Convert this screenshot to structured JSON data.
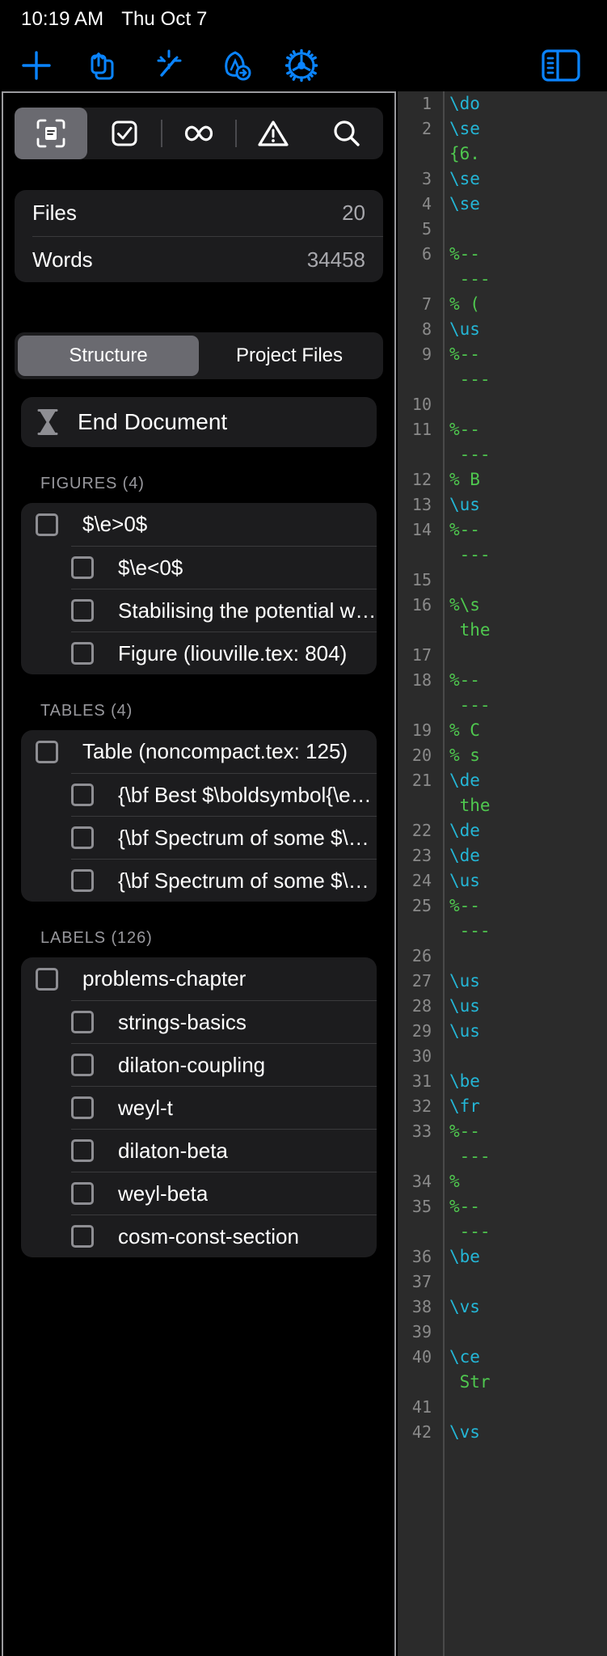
{
  "status_bar": {
    "time": "10:19 AM",
    "date": "Thu Oct 7"
  },
  "app_toolbar": {
    "icons": [
      {
        "name": "add-icon",
        "label": "+"
      },
      {
        "name": "share-icon",
        "label": "Share"
      },
      {
        "name": "magic-wand-icon",
        "label": "Magic"
      },
      {
        "name": "typeset-icon",
        "label": "Typeset"
      },
      {
        "name": "settings-gear-icon",
        "label": "Settings"
      }
    ],
    "right_icon": {
      "name": "sidebar-toggle-icon",
      "label": "Toggle Sidebar"
    }
  },
  "inspector": {
    "segmented": [
      {
        "name": "document-info-tab",
        "icon": "document-scan-icon",
        "active": true
      },
      {
        "name": "todo-tab",
        "icon": "checkbox-icon",
        "active": false
      },
      {
        "name": "math-tab",
        "icon": "infinity-icon",
        "active": false
      },
      {
        "name": "warnings-tab",
        "icon": "warning-triangle-icon",
        "active": false
      },
      {
        "name": "search-tab",
        "icon": "search-icon",
        "active": false
      }
    ],
    "stats": [
      {
        "label": "Files",
        "value": "20"
      },
      {
        "label": "Words",
        "value": "34458"
      }
    ],
    "tabs": [
      {
        "label": "Structure",
        "active": true
      },
      {
        "label": "Project Files",
        "active": false
      }
    ],
    "end_document": {
      "icon": "hourglass-icon",
      "label": "End Document"
    },
    "sections": [
      {
        "title": "FIGURES (4)",
        "items": [
          "$\\e>0$",
          "$\\e<0$",
          "Stabilising the potential whe…",
          "Figure (liouville.tex: 804)"
        ]
      },
      {
        "title": "TABLES (4)",
        "items": [
          "Table (noncompact.tex: 125)",
          "{\\bf Best $\\boldsymbol{\\e >…",
          "{\\bf Spectrum of some $\\bo…",
          "{\\bf Spectrum of some $\\bo…"
        ]
      },
      {
        "title": "LABELS (126)",
        "items": [
          "problems-chapter",
          "strings-basics",
          "dilaton-coupling",
          "weyl-t",
          "dilaton-beta",
          "weyl-beta",
          "cosm-const-section"
        ]
      }
    ]
  },
  "editor": {
    "lines": [
      {
        "n": "1",
        "text": "\\do",
        "kind": "cmd"
      },
      {
        "n": "2",
        "text": "\\se",
        "kind": "cmd"
      },
      {
        "n": "",
        "text": "{6.",
        "kind": "arg"
      },
      {
        "n": "3",
        "text": "\\se",
        "kind": "cmd"
      },
      {
        "n": "4",
        "text": "\\se",
        "kind": "cmd"
      },
      {
        "n": "5",
        "text": "",
        "kind": "com"
      },
      {
        "n": "6",
        "text": "%--",
        "kind": "com"
      },
      {
        "n": "",
        "text": " ---",
        "kind": "com"
      },
      {
        "n": "7",
        "text": "% (",
        "kind": "com"
      },
      {
        "n": "8",
        "text": "\\us",
        "kind": "cmd"
      },
      {
        "n": "9",
        "text": "%--",
        "kind": "com"
      },
      {
        "n": "",
        "text": " ---",
        "kind": "com"
      },
      {
        "n": "10",
        "text": "",
        "kind": "com"
      },
      {
        "n": "11",
        "text": "%--",
        "kind": "com"
      },
      {
        "n": "",
        "text": " ---",
        "kind": "com"
      },
      {
        "n": "12",
        "text": "% B",
        "kind": "com"
      },
      {
        "n": "13",
        "text": "\\us",
        "kind": "cmd"
      },
      {
        "n": "14",
        "text": "%--",
        "kind": "com"
      },
      {
        "n": "",
        "text": " ---",
        "kind": "com"
      },
      {
        "n": "15",
        "text": "",
        "kind": "com"
      },
      {
        "n": "16",
        "text": "%\\s",
        "kind": "com"
      },
      {
        "n": "",
        "text": " the",
        "kind": "com"
      },
      {
        "n": "17",
        "text": "",
        "kind": "com"
      },
      {
        "n": "18",
        "text": "%--",
        "kind": "com"
      },
      {
        "n": "",
        "text": " ---",
        "kind": "com"
      },
      {
        "n": "19",
        "text": "% C",
        "kind": "com"
      },
      {
        "n": "20",
        "text": "% s",
        "kind": "com"
      },
      {
        "n": "21",
        "text": "\\de",
        "kind": "cmd"
      },
      {
        "n": "",
        "text": " the",
        "kind": "com"
      },
      {
        "n": "22",
        "text": "\\de",
        "kind": "cmd"
      },
      {
        "n": "23",
        "text": "\\de",
        "kind": "cmd"
      },
      {
        "n": "24",
        "text": "\\us",
        "kind": "cmd"
      },
      {
        "n": "25",
        "text": "%--",
        "kind": "com"
      },
      {
        "n": "",
        "text": " ---",
        "kind": "com"
      },
      {
        "n": "26",
        "text": "",
        "kind": "com"
      },
      {
        "n": "27",
        "text": "\\us",
        "kind": "cmd"
      },
      {
        "n": "28",
        "text": "\\us",
        "kind": "cmd"
      },
      {
        "n": "29",
        "text": "\\us",
        "kind": "cmd"
      },
      {
        "n": "30",
        "text": "",
        "kind": "com"
      },
      {
        "n": "31",
        "text": "\\be",
        "kind": "cmd"
      },
      {
        "n": "32",
        "text": "\\fr",
        "kind": "cmd"
      },
      {
        "n": "33",
        "text": "%--",
        "kind": "com"
      },
      {
        "n": "",
        "text": " ---",
        "kind": "com"
      },
      {
        "n": "34",
        "text": "%",
        "kind": "com"
      },
      {
        "n": "35",
        "text": "%--",
        "kind": "com"
      },
      {
        "n": "",
        "text": " ---",
        "kind": "com"
      },
      {
        "n": "36",
        "text": "\\be",
        "kind": "cmd"
      },
      {
        "n": "37",
        "text": "",
        "kind": "com"
      },
      {
        "n": "38",
        "text": "\\vs",
        "kind": "cmd"
      },
      {
        "n": "39",
        "text": "",
        "kind": "com"
      },
      {
        "n": "40",
        "text": "\\ce",
        "kind": "cmd"
      },
      {
        "n": "",
        "text": " Str",
        "kind": "com"
      },
      {
        "n": "41",
        "text": "",
        "kind": "com"
      },
      {
        "n": "42",
        "text": "\\vs",
        "kind": "cmd"
      }
    ]
  }
}
